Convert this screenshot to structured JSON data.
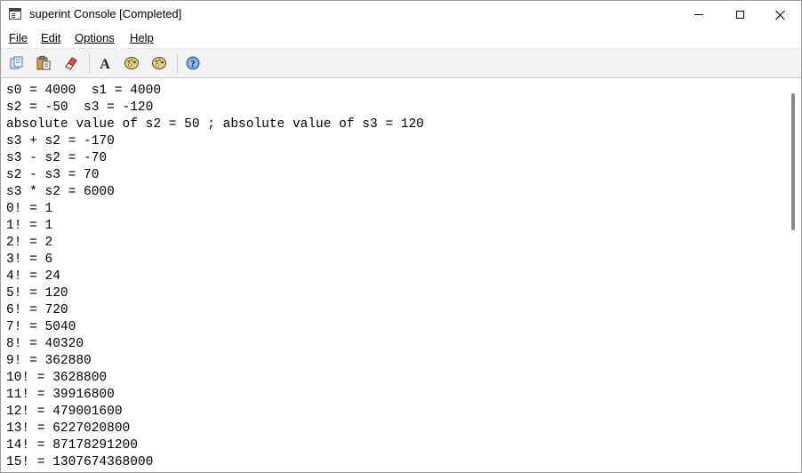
{
  "window": {
    "title": "superint Console [Completed]"
  },
  "menu": {
    "file": "File",
    "edit": "Edit",
    "options": "Options",
    "help": "Help"
  },
  "toolbar": {
    "icons": [
      "copy-icon",
      "paste-icon",
      "clear-icon",
      "font-icon",
      "palette-icon",
      "palette-icon",
      "help-icon"
    ]
  },
  "console": {
    "lines": [
      "s0 = 4000  s1 = 4000",
      "s2 = -50  s3 = -120",
      "absolute value of s2 = 50 ; absolute value of s3 = 120",
      "s3 + s2 = -170",
      "s3 - s2 = -70",
      "s2 - s3 = 70",
      "s3 * s2 = 6000",
      "0! = 1",
      "1! = 1",
      "2! = 2",
      "3! = 6",
      "4! = 24",
      "5! = 120",
      "6! = 720",
      "7! = 5040",
      "8! = 40320",
      "9! = 362880",
      "10! = 3628800",
      "11! = 39916800",
      "12! = 479001600",
      "13! = 6227020800",
      "14! = 87178291200",
      "15! = 1307674368000"
    ]
  }
}
